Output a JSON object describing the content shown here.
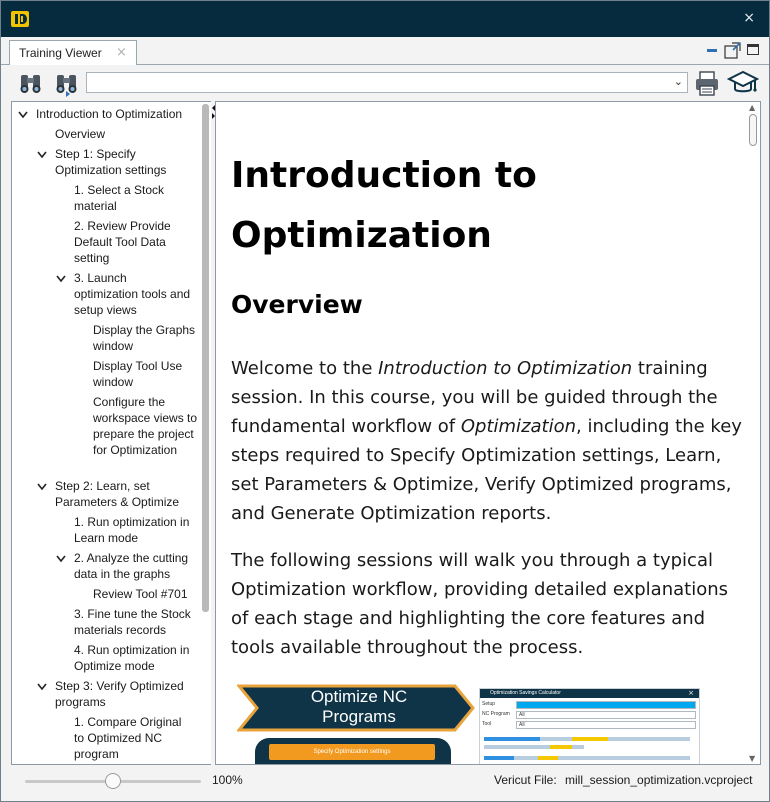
{
  "window": {
    "close_glyph": "×"
  },
  "tab": {
    "label": "Training Viewer",
    "close_glyph": "×"
  },
  "toolbar": {
    "search_icon": "binoculars-icon",
    "search_next_icon": "binoculars-next-icon",
    "combo_value": "",
    "print_icon": "printer-icon",
    "training_icon": "graduation-cap-icon"
  },
  "tree": [
    {
      "label": "Introduction to Optimization",
      "caret": "expanded"
    },
    {
      "label": "Overview"
    },
    {
      "label": "Step 1: Specify Optimization settings",
      "caret": "expanded"
    },
    {
      "label": "1. Select a Stock material"
    },
    {
      "label": "2. Review Provide Default Tool Data setting"
    },
    {
      "label": "3. Launch optimization tools and setup views",
      "caret": "expanded"
    },
    {
      "label": "Display the Graphs window"
    },
    {
      "label": "Display Tool Use window"
    },
    {
      "label": "Configure the workspace views to prepare the project for Optimization"
    },
    {
      "label": "Step 2: Learn, set Parameters & Optimize",
      "caret": "expanded"
    },
    {
      "label": "1. Run optimization in Learn mode"
    },
    {
      "label": "2. Analyze the cutting data in the graphs",
      "caret": "expanded"
    },
    {
      "label": "Review Tool #701"
    },
    {
      "label": "3. Fine tune the Stock materials records"
    },
    {
      "label": "4. Run optimization in Optimize mode"
    },
    {
      "label": "Step 3: Verify Optimized programs",
      "caret": "expanded"
    },
    {
      "label": "1. Compare Original to Optimized NC program"
    }
  ],
  "document": {
    "title": "Introduction to Optimization",
    "section": "Overview",
    "para1": {
      "a": "Welcome to the ",
      "b": "Introduction to Optimization",
      "c": " training session. In this course, you will be guided through the fundamental workflow of ",
      "d": "Optimization",
      "e": ", including the key steps required to Specify Optimization settings, Learn, set Parameters & Optimize, Verify Optimized programs, and Generate Optimization reports."
    },
    "para2": "The following sessions will walk you through a typical Optimization workflow, providing detailed explanations of each stage and highlighting the core features and tools available throughout the process.",
    "figure": {
      "banner": "Optimize NC Programs",
      "step_button": "Specify Optimization settings",
      "calc_title": "Optimization Savings Calculator",
      "calc_rows": [
        {
          "label": "Setup",
          "value": ""
        },
        {
          "label": "NC Program",
          "value": "All"
        },
        {
          "label": "Tool",
          "value": "All"
        }
      ]
    }
  },
  "status": {
    "zoom": "100%",
    "zoom_level": 0.5,
    "file_label": "Vericut File:",
    "file_value": "mill_session_optimization.vcproject"
  },
  "colors": {
    "titlebar": "#062a3e",
    "accent": "#2f6fb3",
    "banner_fill": "#0f3447",
    "banner_border": "#e8a33b",
    "highlight": "#00a8f0"
  }
}
